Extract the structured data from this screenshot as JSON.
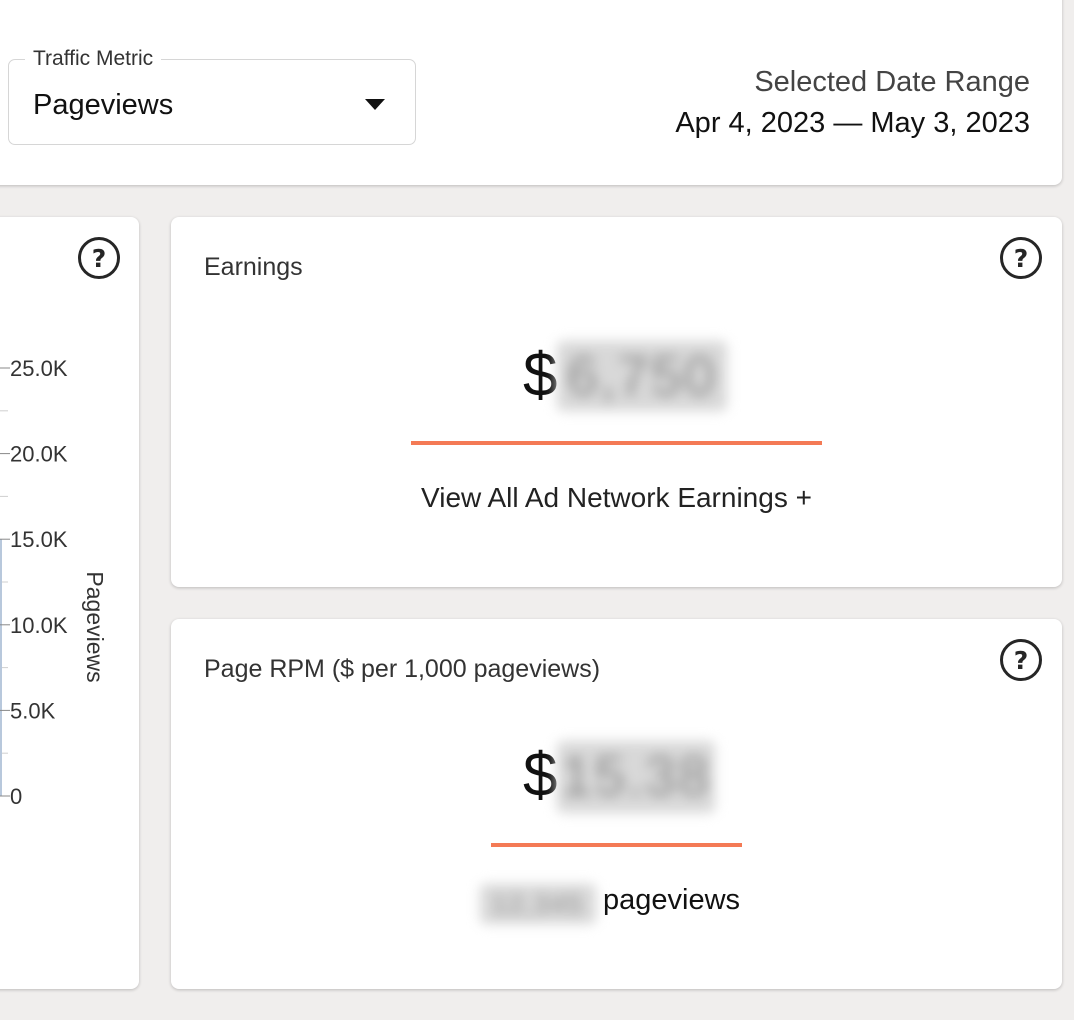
{
  "filters": {
    "traffic_metric_label": "Traffic Metric",
    "traffic_metric_value": "Pageviews",
    "date_range_label": "Selected Date Range",
    "date_range_value": "Apr 4, 2023 — May 3, 2023"
  },
  "chart": {
    "help_icon": "?",
    "y_axis_label": "Pageviews"
  },
  "chart_data": {
    "type": "line",
    "ylabel": "Pageviews",
    "ylim": [
      0,
      25000
    ],
    "y_ticks": [
      "0",
      "5.0K",
      "10.0K",
      "15.0K",
      "20.0K",
      "25.0K"
    ],
    "y_tick_values": [
      0,
      5000,
      10000,
      15000,
      20000,
      25000
    ]
  },
  "earnings": {
    "title": "Earnings",
    "help_icon": "?",
    "currency": "$",
    "amount_redacted": "6,750",
    "link": "View All Ad Network Earnings +"
  },
  "rpm": {
    "title": "Page RPM ($ per 1,000 pageviews)",
    "help_icon": "?",
    "currency": "$",
    "amount_redacted": "15.38",
    "pageviews_redacted": "12,345",
    "pageviews_word": "pageviews"
  },
  "colors": {
    "accent": "#f47a55",
    "background": "#f0eeed",
    "card": "#ffffff"
  }
}
